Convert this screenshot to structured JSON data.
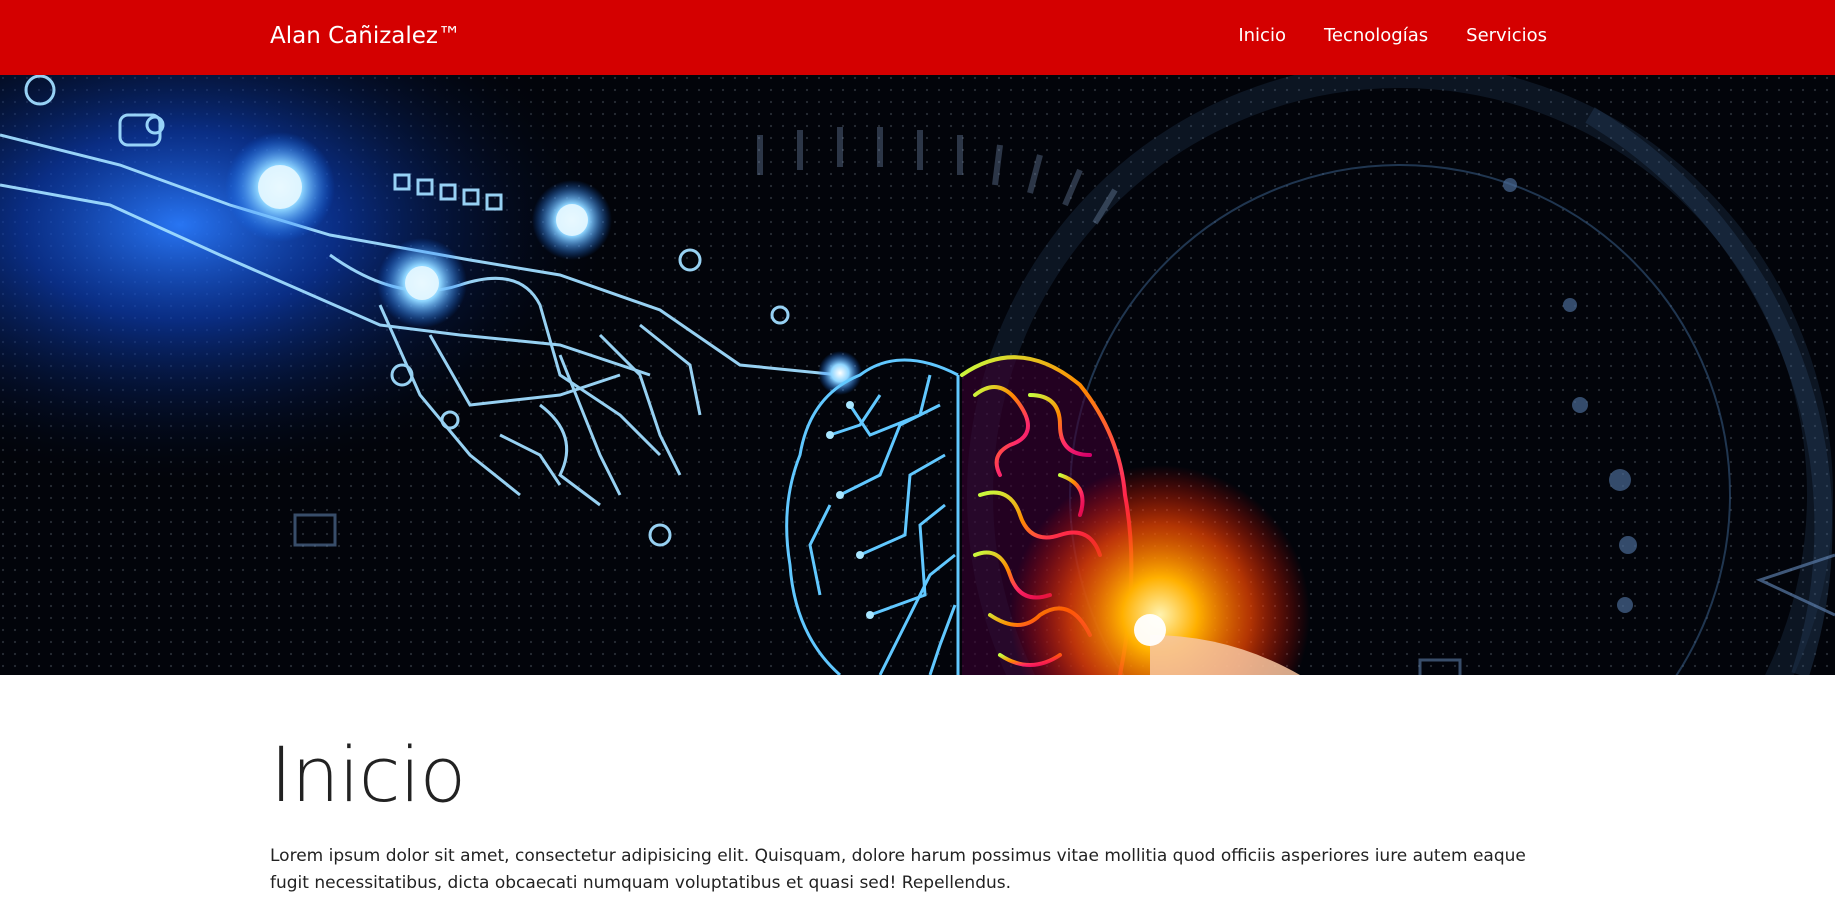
{
  "navbar": {
    "brand": "Alan Cañizalez™",
    "links": [
      "Inicio",
      "Tecnologías",
      "Servicios"
    ],
    "background_color": "#d40000"
  },
  "hero": {
    "image": "robot-hand-touching-circuit-brain-illustration"
  },
  "main": {
    "title": "Inicio",
    "paragraph": "Lorem ipsum dolor sit amet, consectetur adipisicing elit. Quisquam, dolore harum possimus vitae mollitia quod officiis asperiores iure autem eaque fugit necessitatibus, dicta obcaecati numquam voluptatibus et quasi sed! Repellendus."
  }
}
